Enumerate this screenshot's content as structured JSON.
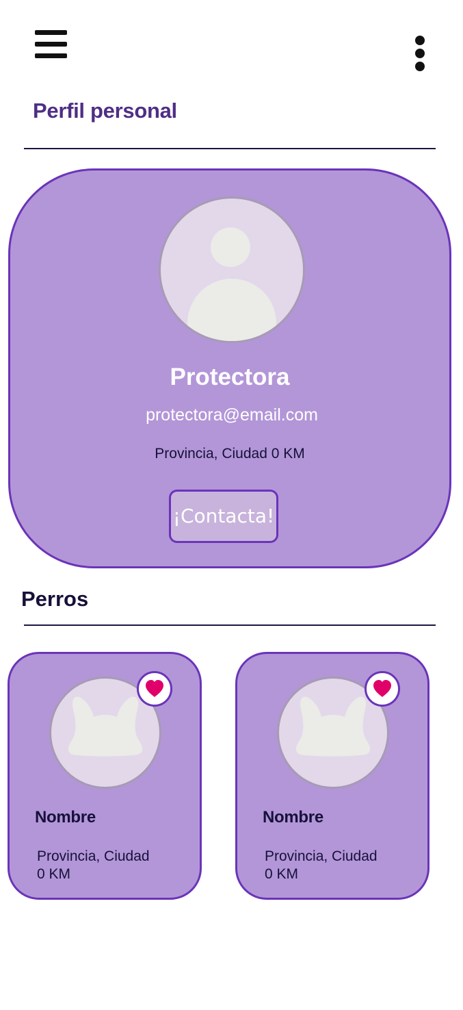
{
  "header": {
    "menu_icon": "hamburger-menu-icon",
    "more_icon": "more-vertical-icon",
    "title": "Perfil personal"
  },
  "profile": {
    "avatar_icon": "user-avatar-icon",
    "name": "Protectora",
    "email": "protectora@email.com",
    "location": "Provincia, Ciudad 0 KM",
    "contact_label": "¡Contacta!"
  },
  "dogs_section": {
    "title": "Perros",
    "items": [
      {
        "name": "Nombre",
        "location_line1": "Provincia, Ciudad",
        "location_line2": "0 KM",
        "favorite_icon": "heart-icon",
        "avatar_icon": "dog-silhouette-icon"
      },
      {
        "name": "Nombre",
        "location_line1": "Provincia, Ciudad",
        "location_line2": "0 KM",
        "favorite_icon": "heart-icon",
        "avatar_icon": "dog-silhouette-icon"
      }
    ]
  },
  "colors": {
    "card_background": "#b396d8",
    "card_border": "#6a34b8",
    "title_purple": "#4f2e85",
    "heart_pink": "#e0006a",
    "dark_text": "#16113a"
  }
}
